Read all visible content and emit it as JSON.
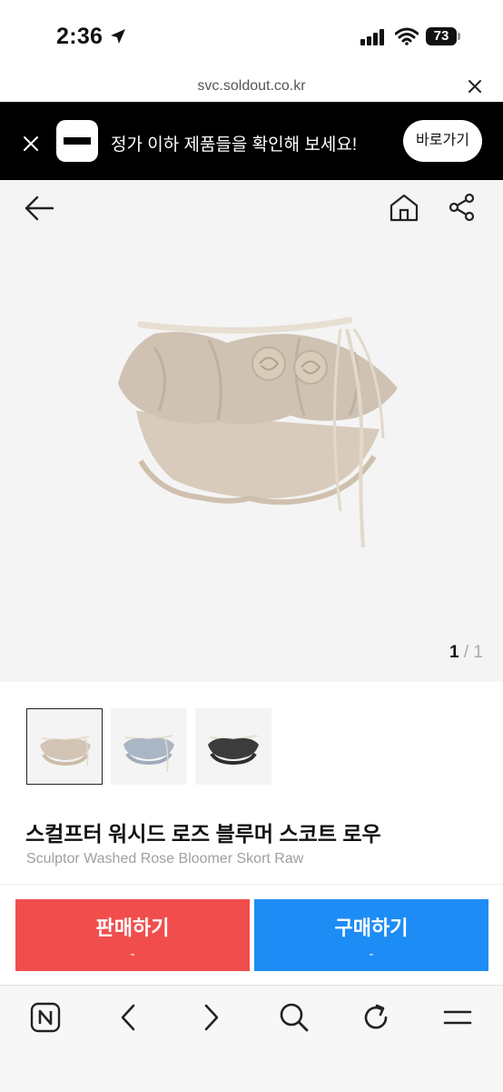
{
  "status_bar": {
    "time": "2:36",
    "battery": "73",
    "icons": [
      "location-arrow-icon",
      "signal-icon",
      "wifi-icon",
      "battery-icon"
    ]
  },
  "browser": {
    "url": "svc.soldout.co.kr",
    "close_icon": "close-icon"
  },
  "banner": {
    "text": "정가 이하 제품들을 확인해 보세요!",
    "button_label": "바로가기",
    "icons": [
      "close-icon",
      "app-logo-icon"
    ]
  },
  "product_nav": {
    "icons": [
      "back-arrow-icon",
      "home-icon",
      "share-icon"
    ]
  },
  "gallery": {
    "current": "1",
    "separator": "/",
    "total": "1",
    "thumbnails": [
      {
        "name": "beige",
        "selected": true
      },
      {
        "name": "light-blue",
        "selected": false
      },
      {
        "name": "dark-grey",
        "selected": false
      }
    ]
  },
  "product": {
    "title_kr": "스컬프터 워시드 로즈 블루머 스코트 로우",
    "title_en": "Sculptor Washed Rose Bloomer Skort Raw"
  },
  "actions": {
    "sell_label": "판매하기",
    "sell_price": "-",
    "buy_label": "구매하기",
    "buy_price": "-"
  },
  "colors": {
    "sell": "#f14d4d",
    "buy": "#1e8cf5",
    "banner_bg": "#000000",
    "gallery_bg": "#f4f4f4"
  },
  "bottom_bar": {
    "icons": [
      "naver-icon",
      "back-icon",
      "forward-icon",
      "search-icon",
      "reload-icon",
      "menu-icon"
    ]
  }
}
